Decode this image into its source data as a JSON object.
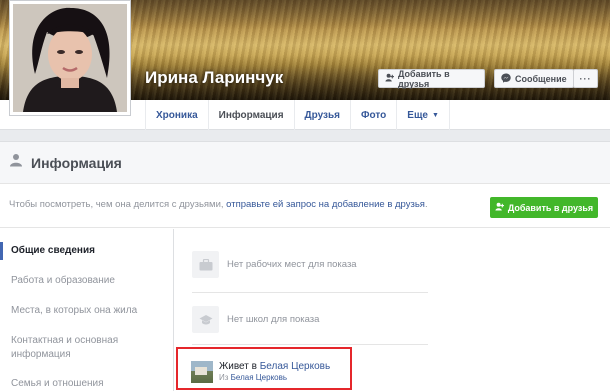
{
  "profile": {
    "name": "Ирина Ларинчук",
    "add_friend_label": "Добавить в друзья",
    "message_label": "Сообщение",
    "more_label": "···"
  },
  "tabs": [
    {
      "label": "Хроника"
    },
    {
      "label": "Информация"
    },
    {
      "label": "Друзья"
    },
    {
      "label": "Фото"
    },
    {
      "label": "Еще"
    }
  ],
  "info": {
    "title": "Информация",
    "notice_prefix": "Чтобы посмотреть, чем она делится с друзьями, ",
    "notice_link": "отправьте ей запрос на добавление в друзья",
    "notice_suffix": ".",
    "add_friend_label": "Добавить в друзья"
  },
  "nav": [
    {
      "label": "Общие сведения"
    },
    {
      "label": "Работа и образование"
    },
    {
      "label": "Места, в которых она жила"
    },
    {
      "label": "Контактная и основная"
    },
    {
      "label": "информация"
    },
    {
      "label": "Семья и отношения"
    }
  ],
  "rows": {
    "work": "Нет рабочих мест для показа",
    "school": "Нет школ для показа",
    "lives_prefix": "Живет в ",
    "lives_city": "Белая Церковь",
    "from_prefix": "Из ",
    "from_city": "Белая Церковь"
  },
  "colors": {
    "link": "#365899",
    "green_button": "#42b72a",
    "highlight": "#e5262b"
  }
}
